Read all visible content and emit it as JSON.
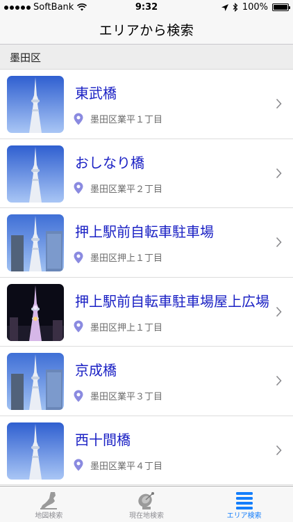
{
  "status_bar": {
    "carrier": "SoftBank",
    "time": "9:32",
    "battery": "100%"
  },
  "nav": {
    "title": "エリアから検索"
  },
  "section": {
    "title": "墨田区"
  },
  "items": [
    {
      "name": "東武橋",
      "address": "墨田区業平１丁目",
      "image": "tower-day"
    },
    {
      "name": "おしなり橋",
      "address": "墨田区業平２丁目",
      "image": "tower-day"
    },
    {
      "name": "押上駅前自転車駐車場",
      "address": "墨田区押上１丁目",
      "image": "tower-buildings"
    },
    {
      "name": "押上駅前自転車駐車場屋上広場",
      "address": "墨田区押上１丁目",
      "image": "tower-night"
    },
    {
      "name": "京成橋",
      "address": "墨田区業平３丁目",
      "image": "tower-buildings"
    },
    {
      "name": "西十間橋",
      "address": "墨田区業平４丁目",
      "image": "tower-day"
    }
  ],
  "tabs": [
    {
      "label": "地図検索",
      "icon": "map-icon",
      "active": false
    },
    {
      "label": "現在地検索",
      "icon": "satellite-dish-icon",
      "active": false
    },
    {
      "label": "エリア検索",
      "icon": "list-icon",
      "active": true
    }
  ],
  "colors": {
    "title_text": "#1a20c4",
    "pin": "#8a8ae0",
    "active_tab": "#147efb",
    "inactive_tab": "#8e8e93"
  }
}
